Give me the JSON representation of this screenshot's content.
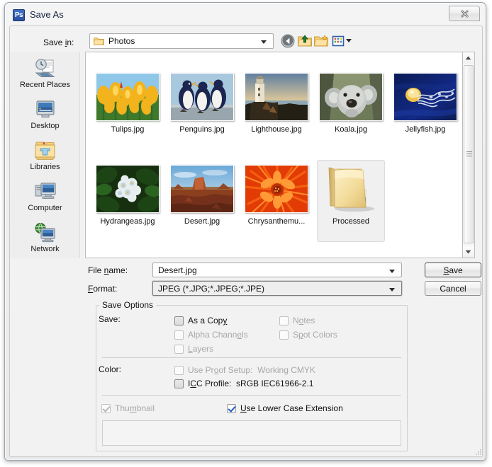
{
  "window": {
    "title": "Save As",
    "app_icon": "photoshop-ps-icon",
    "close_label": "Close"
  },
  "navigation": {
    "save_in_label": "Save in:",
    "current_folder": "Photos",
    "toolbar": [
      {
        "name": "back-icon",
        "tooltip": "Back"
      },
      {
        "name": "up-one-level-icon",
        "tooltip": "Up One Level"
      },
      {
        "name": "new-folder-icon",
        "tooltip": "Create New Folder"
      },
      {
        "name": "views-icon",
        "tooltip": "Views"
      }
    ]
  },
  "places": {
    "items": [
      {
        "label": "Recent Places",
        "icon": "recent-places-icon"
      },
      {
        "label": "Desktop",
        "icon": "desktop-icon"
      },
      {
        "label": "Libraries",
        "icon": "libraries-icon"
      },
      {
        "label": "Computer",
        "icon": "computer-icon"
      },
      {
        "label": "Network",
        "icon": "network-icon"
      }
    ]
  },
  "files": {
    "items": [
      {
        "label": "Tulips.jpg",
        "type": "image",
        "selected": false
      },
      {
        "label": "Penguins.jpg",
        "type": "image",
        "selected": false
      },
      {
        "label": "Lighthouse.jpg",
        "type": "image",
        "selected": false
      },
      {
        "label": "Koala.jpg",
        "type": "image",
        "selected": false
      },
      {
        "label": "Jellyfish.jpg",
        "type": "image",
        "selected": false
      },
      {
        "label": "Hydrangeas.jpg",
        "type": "image",
        "selected": false
      },
      {
        "label": "Desert.jpg",
        "type": "image",
        "selected": false
      },
      {
        "label": "Chrysanthemu...",
        "type": "image",
        "selected": false
      },
      {
        "label": "Processed",
        "type": "folder",
        "selected": true
      }
    ]
  },
  "form": {
    "filename_label": "File name:",
    "filename_value": "Desert.jpg",
    "format_label": "Format:",
    "format_value": "JPEG (*.JPG;*.JPEG;*.JPE)",
    "save_button": "Save",
    "cancel_button": "Cancel"
  },
  "save_options": {
    "group_title": "Save Options",
    "save_label": "Save:",
    "color_label": "Color:",
    "checkboxes": [
      {
        "id": "as-a-copy",
        "label": "As a Copy",
        "checked": false,
        "disabled": false,
        "focused": true
      },
      {
        "id": "notes",
        "label": "Notes",
        "checked": false,
        "disabled": true,
        "focused": false
      },
      {
        "id": "alpha-channels",
        "label": "Alpha Channels",
        "checked": false,
        "disabled": true,
        "focused": false
      },
      {
        "id": "spot-colors",
        "label": "Spot Colors",
        "checked": false,
        "disabled": true,
        "focused": false
      },
      {
        "id": "layers",
        "label": "Layers",
        "checked": false,
        "disabled": true,
        "focused": false
      },
      {
        "id": "use-proof-setup",
        "label": "Use Proof Setup:  Working CMYK",
        "checked": false,
        "disabled": true,
        "focused": false
      },
      {
        "id": "icc-profile",
        "label": "ICC Profile:  sRGB IEC61966-2.1",
        "checked": false,
        "disabled": false,
        "focused": true
      },
      {
        "id": "thumbnail",
        "label": "Thumbnail",
        "checked": true,
        "disabled": true,
        "focused": false
      },
      {
        "id": "lower-case-ext",
        "label": "Use Lower Case Extension",
        "checked": true,
        "disabled": false,
        "focused": false
      }
    ]
  },
  "colors": {
    "accent": "#2b4f9e",
    "dialog_bg": "#f2f2f2",
    "list_bg": "#ffffff",
    "check": "#1f5bbf"
  }
}
